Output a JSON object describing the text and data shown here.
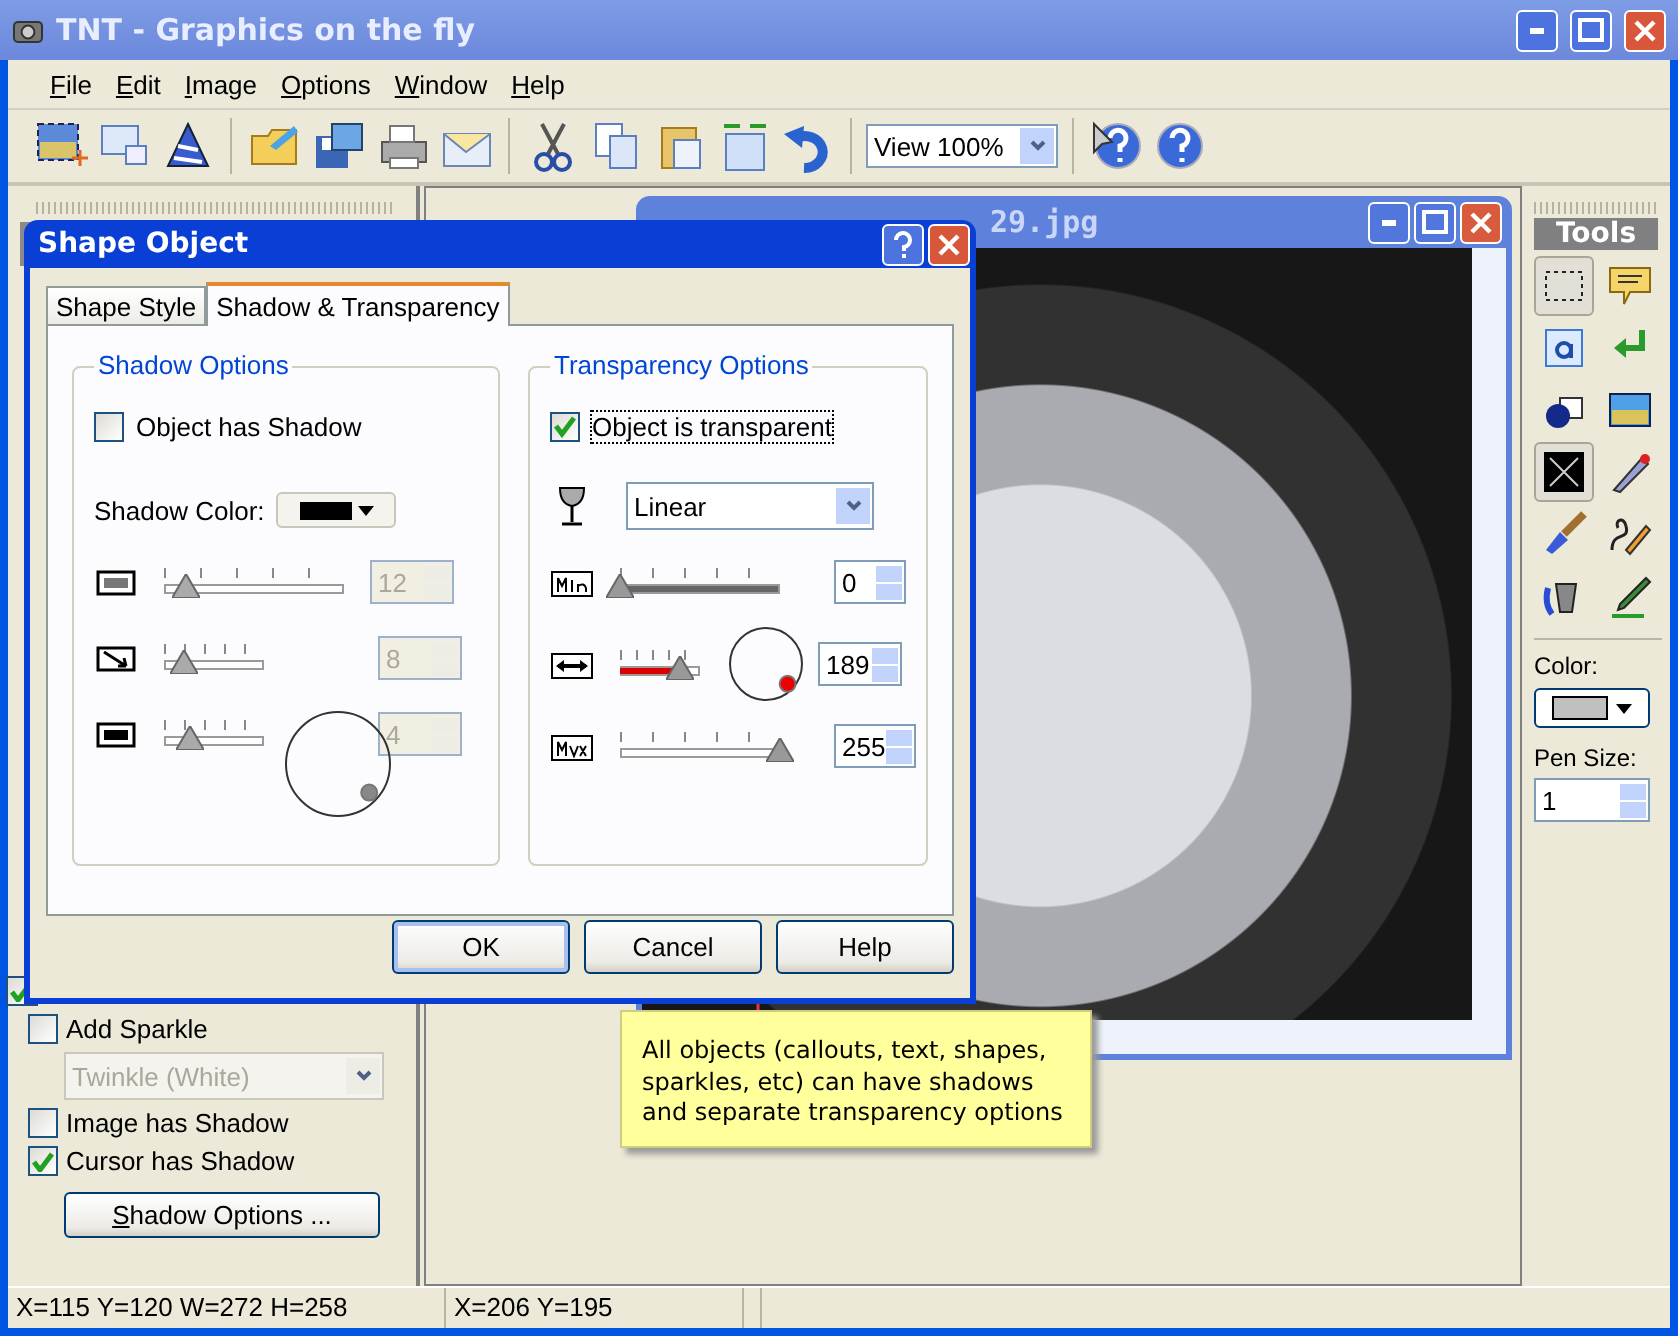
{
  "window": {
    "title": "TNT - Graphics on the fly"
  },
  "menu": [
    {
      "label": "File"
    },
    {
      "label": "Edit"
    },
    {
      "label": "Image"
    },
    {
      "label": "Options"
    },
    {
      "label": "Window"
    },
    {
      "label": "Help"
    }
  ],
  "toolbar": {
    "zoom": "View 100%"
  },
  "left_panel": {
    "items": [
      {
        "kind": "checkbox",
        "checked": true
      },
      {
        "kind": "checkbox",
        "label": "Add Sparkle",
        "checked": false
      },
      {
        "kind": "select",
        "value": "Twinkle (White)",
        "disabled": true
      },
      {
        "kind": "checkbox",
        "label": "Image has Shadow",
        "checked": false
      },
      {
        "kind": "checkbox",
        "label": "Cursor has Shadow",
        "checked": true
      },
      {
        "kind": "button",
        "label": "Shadow Options ..."
      }
    ]
  },
  "image_window": {
    "title": "29.jpg"
  },
  "tools_panel": {
    "title": "Tools",
    "tools": [
      {
        "selected": true
      },
      {
        "selected": false
      },
      {
        "selected": false
      },
      {
        "selected": false
      },
      {
        "selected": false
      },
      {
        "selected": false
      },
      {
        "selected": true
      },
      {
        "selected": false
      },
      {
        "selected": false
      },
      {
        "selected": false
      },
      {
        "selected": false
      },
      {
        "selected": false
      }
    ],
    "color_label": "Color:",
    "pen_size_label": "Pen Size:",
    "pen_size": "1"
  },
  "dialog": {
    "title": "Shape Object",
    "tabs": [
      {
        "label": "Shape Style",
        "selected": false
      },
      {
        "label": "Shadow & Transparency",
        "selected": true
      }
    ],
    "shadow": {
      "title": "Shadow Options",
      "checkbox": {
        "label": "Object has Shadow",
        "checked": false
      },
      "color_label": "Shadow Color:",
      "sliders": [
        {
          "level": 0.12,
          "value": "12",
          "disabled": true
        },
        {
          "level": 0.2,
          "value": "8",
          "disabled": true
        },
        {
          "level": 0.25,
          "value": "4",
          "disabled": true
        }
      ]
    },
    "transparency": {
      "title": "Transparency Options",
      "checkbox": {
        "label": "Object is transparent",
        "checked": true
      },
      "mode": "Linear",
      "sliders": [
        {
          "level": 0,
          "value": "0"
        },
        {
          "level": 0.74,
          "value": "189"
        },
        {
          "level": 1,
          "value": "255"
        }
      ]
    },
    "buttons": [
      {
        "label": "OK"
      },
      {
        "label": "Cancel"
      },
      {
        "label": "Help"
      }
    ]
  },
  "callout": {
    "text": "All objects (callouts, text, shapes, sparkles, etc) can have shadows and separate transparency options"
  },
  "status_bar": [
    "X=115 Y=120 W=272 H=258",
    "X=206  Y=195"
  ]
}
